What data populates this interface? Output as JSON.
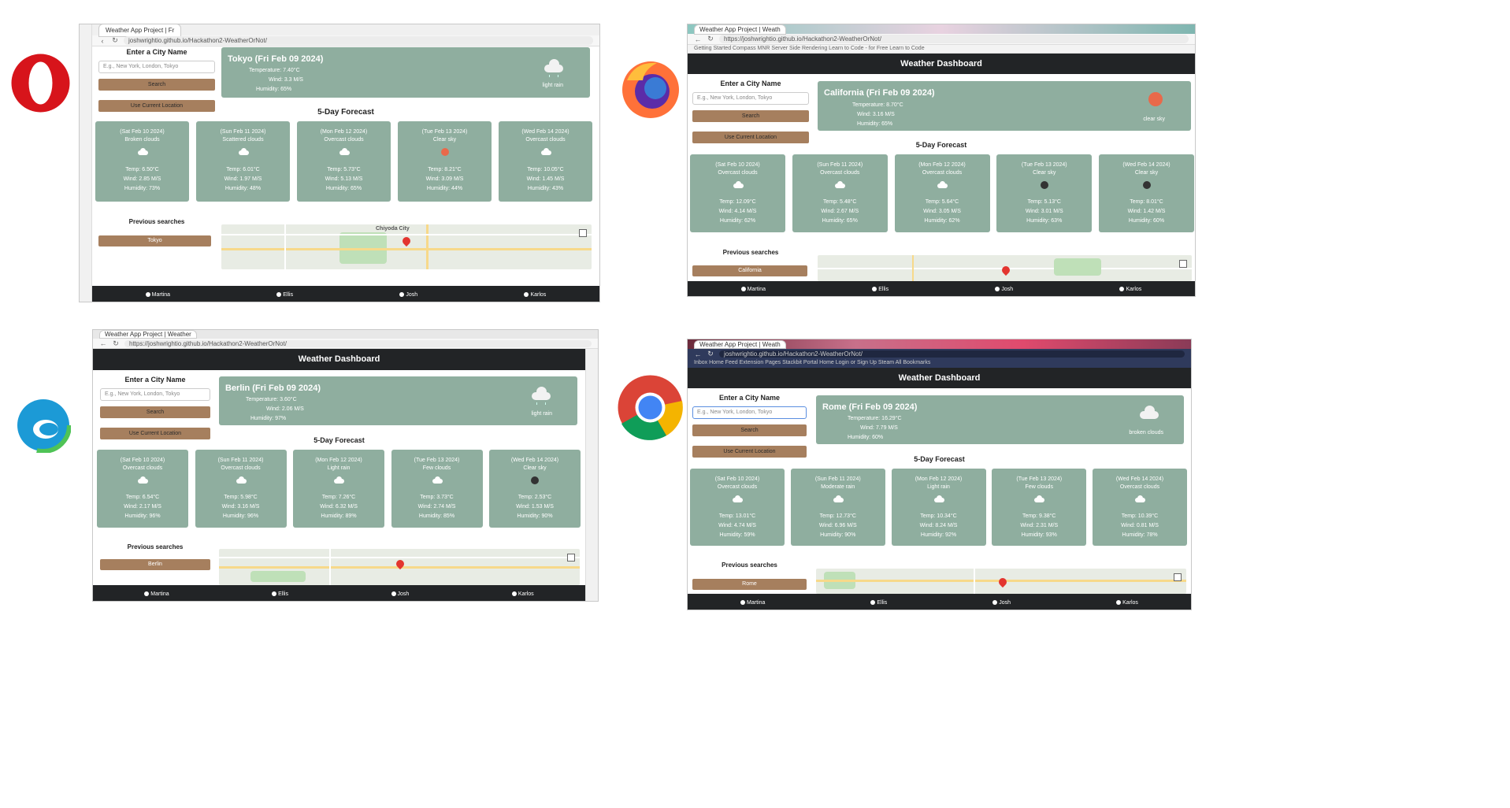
{
  "browsers": {
    "opera": {
      "logo": "opera-logo-icon",
      "tab": "Weather App Project | Fr",
      "url": "joshwrightio.github.io/Hackathon2-WeatherOrNot/",
      "city": "Tokyo (Fri Feb 09 2024)",
      "temp": "Temperature: 7.40°C",
      "wind": "Wind: 3.3 M/S",
      "hum": "Humidity: 65%",
      "desc": "light rain",
      "icon": "rain-cloud",
      "prev": "Tokyo",
      "map_label": "Chiyoda City",
      "days": [
        {
          "date": "(Sat Feb 10 2024)",
          "cond": "Broken clouds",
          "icon": "cloud",
          "temp": "Temp: 6.50°C",
          "wind": "Wind: 2.85 M/S",
          "hum": "Humidity: 73%"
        },
        {
          "date": "(Sun Feb 11 2024)",
          "cond": "Scattered clouds",
          "icon": "cloud",
          "temp": "Temp: 6.01°C",
          "wind": "Wind: 1.97 M/S",
          "hum": "Humidity: 48%"
        },
        {
          "date": "(Mon Feb 12 2024)",
          "cond": "Overcast clouds",
          "icon": "cloud",
          "temp": "Temp: 5.73°C",
          "wind": "Wind: 5.13 M/S",
          "hum": "Humidity: 65%"
        },
        {
          "date": "(Tue Feb 13 2024)",
          "cond": "Clear sky",
          "icon": "sun",
          "temp": "Temp: 8.21°C",
          "wind": "Wind: 3.09 M/S",
          "hum": "Humidity: 44%"
        },
        {
          "date": "(Wed Feb 14 2024)",
          "cond": "Overcast clouds",
          "icon": "cloud",
          "temp": "Temp: 10.05°C",
          "wind": "Wind: 1.45 M/S",
          "hum": "Humidity: 43%"
        }
      ]
    },
    "firefox": {
      "logo": "firefox-logo-icon",
      "tab": "Weather App Project | Weath",
      "url": "https://joshwrightio.github.io/Hackathon2-WeatherOrNot/",
      "bookmarks": "Getting Started   Compass MNR   Server Side Rendering   Learn to Code - for Free   Learn to Code",
      "city": "California (Fri Feb 09 2024)",
      "temp": "Temperature: 8.70°C",
      "wind": "Wind: 3.16 M/S",
      "hum": "Humidity: 65%",
      "desc": "clear sky",
      "icon": "sun",
      "prev": "California",
      "days": [
        {
          "date": "(Sat Feb 10 2024)",
          "cond": "Overcast clouds",
          "icon": "cloud",
          "temp": "Temp: 12.09°C",
          "wind": "Wind: 4.14 M/S",
          "hum": "Humidity: 62%"
        },
        {
          "date": "(Sun Feb 11 2024)",
          "cond": "Overcast clouds",
          "icon": "cloud",
          "temp": "Temp: 5.48°C",
          "wind": "Wind: 2.67 M/S",
          "hum": "Humidity: 65%"
        },
        {
          "date": "(Mon Feb 12 2024)",
          "cond": "Overcast clouds",
          "icon": "cloud",
          "temp": "Temp: 5.64°C",
          "wind": "Wind: 3.05 M/S",
          "hum": "Humidity: 62%"
        },
        {
          "date": "(Tue Feb 13 2024)",
          "cond": "Clear sky",
          "icon": "sun-dark",
          "temp": "Temp: 5.13°C",
          "wind": "Wind: 3.01 M/S",
          "hum": "Humidity: 63%"
        },
        {
          "date": "(Wed Feb 14 2024)",
          "cond": "Clear sky",
          "icon": "sun-dark",
          "temp": "Temp: 8.01°C",
          "wind": "Wind: 1.42 M/S",
          "hum": "Humidity: 60%"
        }
      ]
    },
    "edge": {
      "logo": "edge-logo-icon",
      "tab": "Weather App Project | Weather",
      "url": "https://joshwrightio.github.io/Hackathon2-WeatherOrNot/",
      "city": "Berlin (Fri Feb 09 2024)",
      "temp": "Temperature: 3.60°C",
      "wind": "Wind: 2.06 M/S",
      "hum": "Humidity: 97%",
      "desc": "light rain",
      "icon": "rain-cloud",
      "prev": "Berlin",
      "days": [
        {
          "date": "(Sat Feb 10 2024)",
          "cond": "Overcast clouds",
          "icon": "cloud",
          "temp": "Temp: 6.54°C",
          "wind": "Wind: 2.17 M/S",
          "hum": "Humidity: 96%"
        },
        {
          "date": "(Sun Feb 11 2024)",
          "cond": "Overcast clouds",
          "icon": "cloud",
          "temp": "Temp: 5.98°C",
          "wind": "Wind: 3.16 M/S",
          "hum": "Humidity: 96%"
        },
        {
          "date": "(Mon Feb 12 2024)",
          "cond": "Light rain",
          "icon": "cloud",
          "temp": "Temp: 7.26°C",
          "wind": "Wind: 6.32 M/S",
          "hum": "Humidity: 89%"
        },
        {
          "date": "(Tue Feb 13 2024)",
          "cond": "Few clouds",
          "icon": "cloud",
          "temp": "Temp: 3.73°C",
          "wind": "Wind: 2.74 M/S",
          "hum": "Humidity: 85%"
        },
        {
          "date": "(Wed Feb 14 2024)",
          "cond": "Clear sky",
          "icon": "sun-dark",
          "temp": "Temp: 2.53°C",
          "wind": "Wind: 1.53 M/S",
          "hum": "Humidity: 90%"
        }
      ]
    },
    "chrome": {
      "logo": "chrome-logo-icon",
      "tab": "Weather App Project | Weath",
      "url": "joshwrightio.github.io/Hackathon2-WeatherOrNot/",
      "bookmarks": "Inbox   Home Feed   Extension   Pages   Stackbit Portal Home   Login or Sign Up   Steam   All Bookmarks",
      "city": "Rome (Fri Feb 09 2024)",
      "temp": "Temperature: 16.29°C",
      "wind": "Wind: 7.79 M/S",
      "hum": "Humidity: 60%",
      "desc": "broken clouds",
      "icon": "big-cloud",
      "prev": "Rome",
      "days": [
        {
          "date": "(Sat Feb 10 2024)",
          "cond": "Overcast clouds",
          "icon": "cloud",
          "temp": "Temp: 13.01°C",
          "wind": "Wind: 4.74 M/S",
          "hum": "Humidity: 59%"
        },
        {
          "date": "(Sun Feb 11 2024)",
          "cond": "Moderate rain",
          "icon": "cloud",
          "temp": "Temp: 12.73°C",
          "wind": "Wind: 6.96 M/S",
          "hum": "Humidity: 90%"
        },
        {
          "date": "(Mon Feb 12 2024)",
          "cond": "Light rain",
          "icon": "cloud",
          "temp": "Temp: 10.34°C",
          "wind": "Wind: 8.24 M/S",
          "hum": "Humidity: 92%"
        },
        {
          "date": "(Tue Feb 13 2024)",
          "cond": "Few clouds",
          "icon": "cloud",
          "temp": "Temp: 9.38°C",
          "wind": "Wind: 2.31 M/S",
          "hum": "Humidity: 93%"
        },
        {
          "date": "(Wed Feb 14 2024)",
          "cond": "Overcast clouds",
          "icon": "cloud",
          "temp": "Temp: 10.39°C",
          "wind": "Wind: 0.81 M/S",
          "hum": "Humidity: 78%"
        }
      ]
    }
  },
  "common": {
    "header": "Weather Dashboard",
    "enter_city": "Enter a City Name",
    "placeholder": "E.g., New York, London, Tokyo",
    "search": "Search",
    "use_location": "Use Current Location",
    "forecast_title": "5-Day Forecast",
    "prev_title": "Previous searches",
    "footer": [
      "Martina",
      "Ellis",
      "Josh",
      "Karlos"
    ]
  },
  "colors": {
    "card": "#8fae9f",
    "button": "#a67f5e",
    "header": "#222426",
    "opera": "#d7141b",
    "firefox": "#ff7139",
    "edge": "#1c9ad6",
    "chrome_blue": "#4285f4"
  }
}
